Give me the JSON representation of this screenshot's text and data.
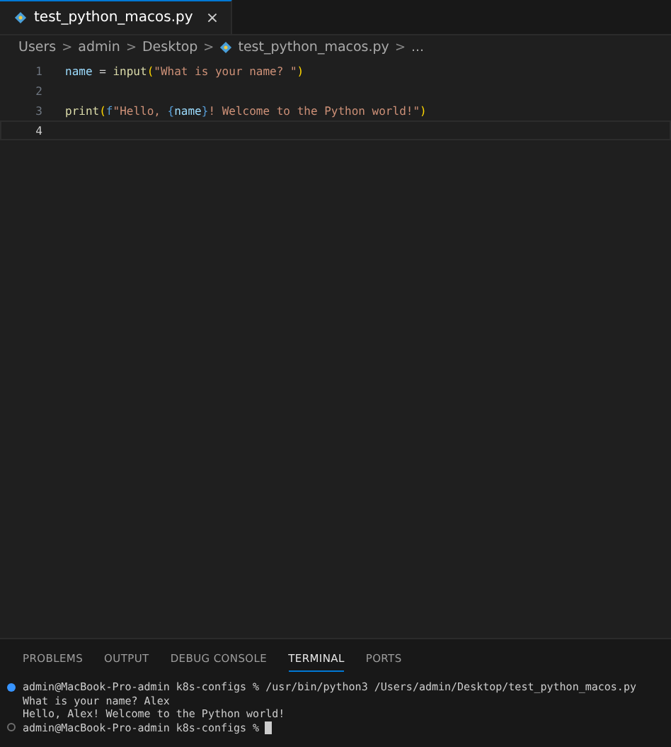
{
  "editor_tabs": [
    {
      "label": "test_python_macos.py",
      "close": "×",
      "selected": true
    }
  ],
  "breadcrumbs": [
    {
      "label": "Users",
      "kind": "folder"
    },
    {
      "label": "admin",
      "kind": "folder"
    },
    {
      "label": "Desktop",
      "kind": "folder"
    },
    {
      "label": "test_python_macos.py",
      "kind": "file"
    },
    {
      "label": "...",
      "kind": "more"
    }
  ],
  "separator": ">",
  "code_lines": [
    {
      "number": "1",
      "current": false,
      "tokens": [
        {
          "text": "name",
          "kind": "variable"
        },
        {
          "text": " = ",
          "kind": "operator"
        },
        {
          "text": "input",
          "kind": "function"
        },
        {
          "text": "(",
          "kind": "paren"
        },
        {
          "text": "\"What is your name? \"",
          "kind": "string"
        },
        {
          "text": ")",
          "kind": "paren"
        }
      ]
    },
    {
      "number": "2",
      "current": false
    },
    {
      "number": "3",
      "current": false,
      "tokens": [
        {
          "text": "print",
          "kind": "function"
        },
        {
          "text": "(",
          "kind": "paren"
        },
        {
          "text": "f",
          "kind": "keyword"
        },
        {
          "text": "\"Hello, ",
          "kind": "string"
        },
        {
          "text": "{",
          "kind": "brace"
        },
        {
          "text": "name",
          "kind": "variable"
        },
        {
          "text": "}",
          "kind": "brace"
        },
        {
          "text": "! Welcome to the Python world!\"",
          "kind": "string"
        },
        {
          "text": ")",
          "kind": "paren"
        }
      ]
    },
    {
      "number": "4",
      "current": true
    }
  ],
  "panel_tabs": [
    {
      "label": "PROBLEMS",
      "selected": false
    },
    {
      "label": "OUTPUT",
      "selected": false
    },
    {
      "label": "DEBUG CONSOLE",
      "selected": false
    },
    {
      "label": "TERMINAL",
      "selected": true
    },
    {
      "label": "PORTS",
      "selected": false
    }
  ],
  "terminal_lines": [
    {
      "text": "admin@MacBook-Pro-admin k8s-configs % /usr/bin/python3 /Users/admin/Desktop/test_python_macos.py",
      "kind": "command-done"
    },
    {
      "text": "What is your name? Alex",
      "kind": "output"
    },
    {
      "text": "Hello, Alex! Welcome to the Python world!",
      "kind": "output"
    },
    {
      "text": "admin@MacBook-Pro-admin k8s-configs %",
      "kind": "command-open",
      "cursor": true
    }
  ]
}
